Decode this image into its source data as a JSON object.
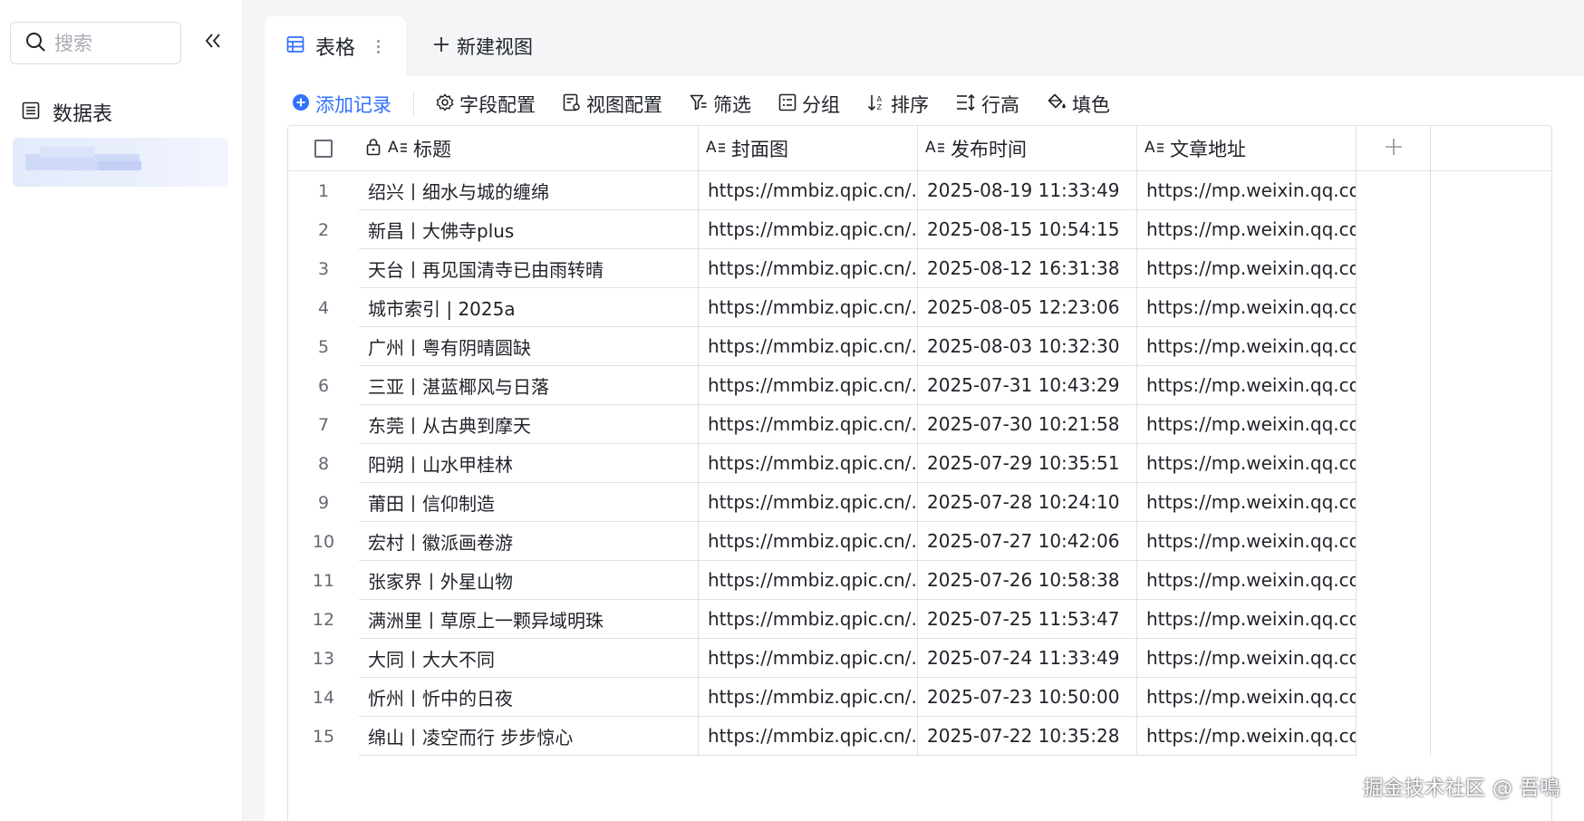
{
  "sidebar": {
    "search_placeholder": "搜索",
    "nav_items": [
      {
        "label": "数据表"
      }
    ]
  },
  "tabs": {
    "active": {
      "label": "表格"
    },
    "new_view": {
      "label": "新建视图"
    }
  },
  "toolbar": {
    "add_record": "添加记录",
    "field_config": "字段配置",
    "view_config": "视图配置",
    "filter": "筛选",
    "group": "分组",
    "sort": "排序",
    "row_height": "行高",
    "fill_color": "填色"
  },
  "table": {
    "columns": [
      {
        "label": "标题"
      },
      {
        "label": "封面图"
      },
      {
        "label": "发布时间"
      },
      {
        "label": "文章地址"
      }
    ],
    "rows": [
      {
        "num": "1",
        "title": "绍兴丨细水与城的缠绵",
        "cover": "https://mmbiz.qpic.cn/...",
        "time": "2025-08-19 11:33:49",
        "url": "https://mp.weixin.qq.co..."
      },
      {
        "num": "2",
        "title": "新昌丨大佛寺plus",
        "cover": "https://mmbiz.qpic.cn/...",
        "time": "2025-08-15 10:54:15",
        "url": "https://mp.weixin.qq.co..."
      },
      {
        "num": "3",
        "title": "天台丨再见国清寺已由雨转晴",
        "cover": "https://mmbiz.qpic.cn/...",
        "time": "2025-08-12 16:31:38",
        "url": "https://mp.weixin.qq.co..."
      },
      {
        "num": "4",
        "title": "城市索引 | 2025a",
        "cover": "https://mmbiz.qpic.cn/...",
        "time": "2025-08-05 12:23:06",
        "url": "https://mp.weixin.qq.co..."
      },
      {
        "num": "5",
        "title": "广州丨粤有阴晴圆缺",
        "cover": "https://mmbiz.qpic.cn/...",
        "time": "2025-08-03 10:32:30",
        "url": "https://mp.weixin.qq.co..."
      },
      {
        "num": "6",
        "title": "三亚丨湛蓝椰风与日落",
        "cover": "https://mmbiz.qpic.cn/...",
        "time": "2025-07-31 10:43:29",
        "url": "https://mp.weixin.qq.co..."
      },
      {
        "num": "7",
        "title": "东莞丨从古典到摩天",
        "cover": "https://mmbiz.qpic.cn/...",
        "time": "2025-07-30 10:21:58",
        "url": "https://mp.weixin.qq.co..."
      },
      {
        "num": "8",
        "title": "阳朔丨山水甲桂林",
        "cover": "https://mmbiz.qpic.cn/...",
        "time": "2025-07-29 10:35:51",
        "url": "https://mp.weixin.qq.co..."
      },
      {
        "num": "9",
        "title": "莆田丨信仰制造",
        "cover": "https://mmbiz.qpic.cn/...",
        "time": "2025-07-28 10:24:10",
        "url": "https://mp.weixin.qq.co..."
      },
      {
        "num": "10",
        "title": "宏村丨徽派画卷游",
        "cover": "https://mmbiz.qpic.cn/...",
        "time": "2025-07-27 10:42:06",
        "url": "https://mp.weixin.qq.co..."
      },
      {
        "num": "11",
        "title": "张家界丨外星山物",
        "cover": "https://mmbiz.qpic.cn/...",
        "time": "2025-07-26 10:58:38",
        "url": "https://mp.weixin.qq.co..."
      },
      {
        "num": "12",
        "title": "满洲里丨草原上一颗异域明珠",
        "cover": "https://mmbiz.qpic.cn/...",
        "time": "2025-07-25 11:53:47",
        "url": "https://mp.weixin.qq.co..."
      },
      {
        "num": "13",
        "title": "大同丨大大不同",
        "cover": "https://mmbiz.qpic.cn/...",
        "time": "2025-07-24 11:33:49",
        "url": "https://mp.weixin.qq.co..."
      },
      {
        "num": "14",
        "title": "忻州丨忻中的日夜",
        "cover": "https://mmbiz.qpic.cn/...",
        "time": "2025-07-23 10:50:00",
        "url": "https://mp.weixin.qq.co..."
      },
      {
        "num": "15",
        "title": "绵山丨凌空而行 步步惊心",
        "cover": "https://mmbiz.qpic.cn/...",
        "time": "2025-07-22 10:35:28",
        "url": "https://mp.weixin.qq.co..."
      }
    ]
  },
  "watermark": "掘金技术社区 @ 吾鳴",
  "colors": {
    "accent": "#3370ff",
    "border": "#dee0e3",
    "text": "#1f2329",
    "muted": "#646a73"
  }
}
